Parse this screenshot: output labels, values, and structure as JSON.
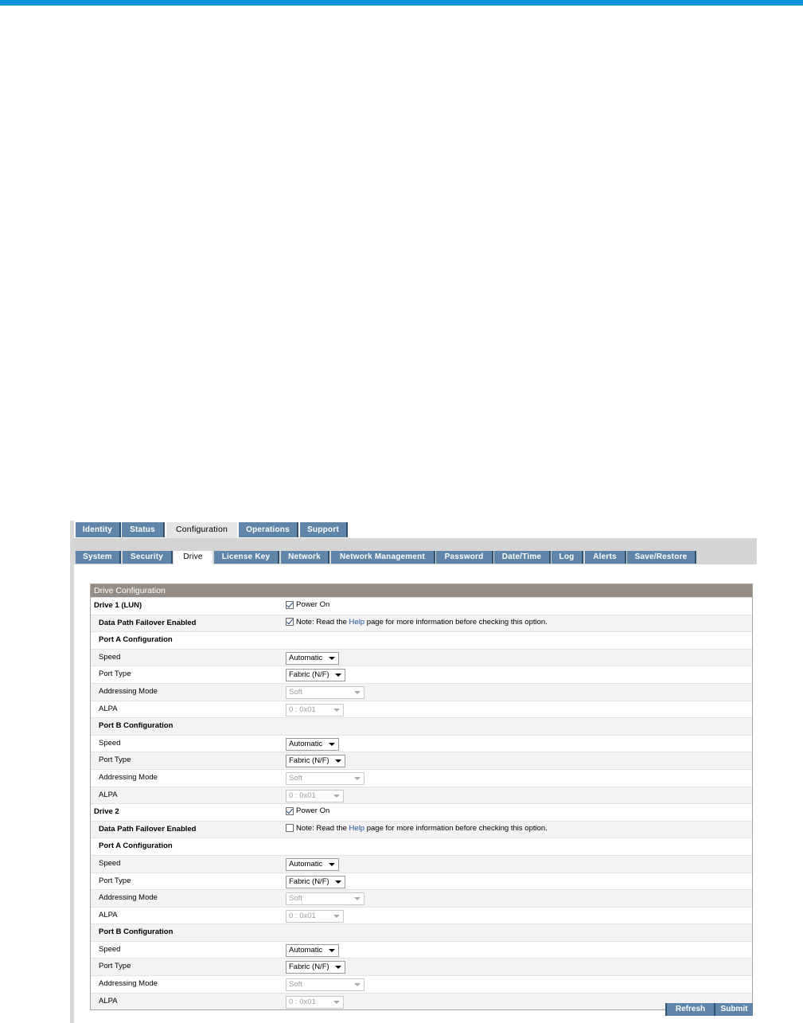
{
  "main_tabs": [
    "Identity",
    "Status",
    "Configuration",
    "Operations",
    "Support"
  ],
  "sub_tabs": [
    "System",
    "Security",
    "Drive",
    "License Key",
    "Network",
    "Network Management",
    "Password",
    "Date/Time",
    "Log",
    "Alerts",
    "Save/Restore"
  ],
  "panel": {
    "title": "Drive Configuration"
  },
  "labels": {
    "power_on": "Power On",
    "failover": "Data Path Failover Enabled",
    "port_a": "Port A Configuration",
    "port_b": "Port B Configuration",
    "speed": "Speed",
    "port_type": "Port Type",
    "addressing_mode": "Addressing Mode",
    "alpa": "ALPA",
    "note_prefix": "Note: Read the ",
    "note_link": "Help",
    "note_suffix": " page for more information before checking this option."
  },
  "drives": [
    {
      "name": "Drive 1 (LUN)",
      "power_on": true,
      "failover": true,
      "port_a": {
        "speed": "Automatic",
        "port_type": "Fabric (N/F)",
        "addressing_mode": "Soft",
        "alpa": "0 : 0x01"
      },
      "port_b": {
        "speed": "Automatic",
        "port_type": "Fabric (N/F)",
        "addressing_mode": "Soft",
        "alpa": "0 : 0x01"
      }
    },
    {
      "name": "Drive 2",
      "power_on": true,
      "failover": false,
      "port_a": {
        "speed": "Automatic",
        "port_type": "Fabric (N/F)",
        "addressing_mode": "Soft",
        "alpa": "0 : 0x01"
      },
      "port_b": {
        "speed": "Automatic",
        "port_type": "Fabric (N/F)",
        "addressing_mode": "Soft",
        "alpa": "0 : 0x01"
      }
    }
  ],
  "buttons": {
    "refresh": "Refresh",
    "submit": "Submit"
  },
  "colors": {
    "accent_bar": "#0a94d6",
    "tab": "#5f86a8",
    "panel_header": "#958c85"
  }
}
